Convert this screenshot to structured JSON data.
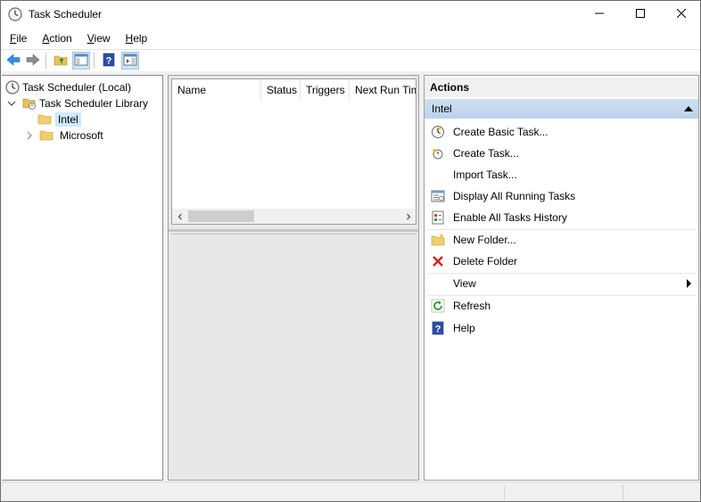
{
  "window": {
    "title": "Task Scheduler",
    "controls": {
      "minimize_icon": "minimize-icon",
      "maximize_icon": "maximize-icon",
      "close_icon": "close-icon"
    }
  },
  "menu": {
    "items": [
      {
        "key": "F",
        "rest": "ile"
      },
      {
        "key": "A",
        "rest": "ction"
      },
      {
        "key": "V",
        "rest": "iew"
      },
      {
        "key": "H",
        "rest": "elp"
      }
    ]
  },
  "toolbar": {
    "buttons": [
      "back-icon",
      "forward-icon",
      "up-folder-icon",
      "show-hide-console-tree-icon",
      "help-icon",
      "show-hide-action-pane-icon"
    ]
  },
  "tree": {
    "root": "Task Scheduler (Local)",
    "library": "Task Scheduler Library",
    "children": [
      "Intel",
      "Microsoft"
    ],
    "selected": "Intel"
  },
  "task_list": {
    "columns": [
      "Name",
      "Status",
      "Triggers",
      "Next Run Tim"
    ]
  },
  "actions": {
    "header": "Actions",
    "section": "Intel",
    "items": [
      {
        "label": "Create Basic Task...",
        "icon": "create-basic-task-icon"
      },
      {
        "label": "Create Task...",
        "icon": "create-task-icon"
      },
      {
        "label": "Import Task...",
        "icon": ""
      },
      {
        "label": "Display All Running Tasks",
        "icon": "running-tasks-icon"
      },
      {
        "label": "Enable All Tasks History",
        "icon": "tasks-history-icon"
      },
      {
        "label": "New Folder...",
        "icon": "new-folder-icon"
      },
      {
        "label": "Delete Folder",
        "icon": "delete-icon"
      },
      {
        "label": "View",
        "icon": ""
      },
      {
        "label": "Refresh",
        "icon": "refresh-icon"
      },
      {
        "label": "Help",
        "icon": "help-icon"
      }
    ]
  },
  "colors": {
    "selection": "#cce8ff",
    "actions_section": "#c4d9ef",
    "delete_red": "#d81e1e",
    "help_blue": "#2b4fa8"
  }
}
